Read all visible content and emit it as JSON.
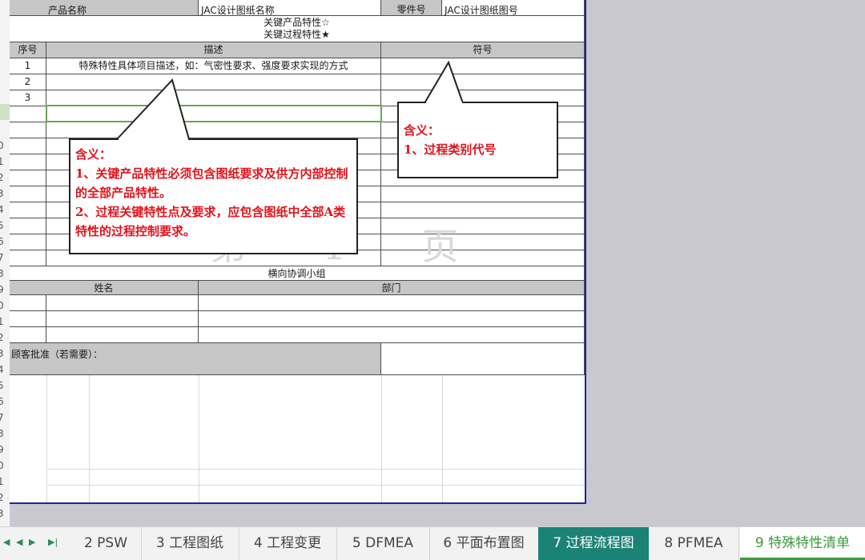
{
  "row_headers": [
    "",
    "",
    "",
    "",
    "",
    "",
    "",
    "",
    "0",
    "1",
    "2",
    "3",
    "4",
    "5",
    "6",
    "7",
    "8",
    "9",
    "0",
    "1",
    "2",
    "3",
    "4",
    "5",
    "6",
    "7",
    "8",
    "9",
    "0",
    "1",
    "2",
    "3"
  ],
  "header": {
    "product_name_label": "产品名称",
    "product_name_value": "JAC设计图纸名称",
    "part_no_label": "零件号",
    "part_no_value": "JAC设计图纸图号",
    "key_product_char": "关键产品特性☆",
    "key_process_char": "关键过程特性★"
  },
  "table": {
    "col_seq": "序号",
    "col_desc": "描述",
    "col_symbol": "符号",
    "rows": [
      {
        "seq": "1",
        "desc": "特殊特性具体项目描述，如：气密性要求、强度要求实现的方式"
      },
      {
        "seq": "2",
        "desc": ""
      },
      {
        "seq": "3",
        "desc": ""
      }
    ]
  },
  "team": {
    "title": "横向协调小组",
    "col_name": "姓名",
    "col_dept": "部门"
  },
  "approval_label": "顾客批准（若需要）：",
  "watermark": "第 1 页",
  "callout_left": {
    "line1": "含义：",
    "line2": "1、关键产品特性必须包含图纸要求及供方内部控制的全部产品特性。",
    "line3": "2、过程关键特性点及要求，应包含图纸中全部A类特性的过程控制要求。"
  },
  "callout_right": {
    "line1": "含义：",
    "line2": "1、过程类别代号"
  },
  "tabs": [
    "2 PSW",
    "3 工程图纸",
    "4 工程变更",
    "5 DFMEA",
    "6 平面布置图",
    "7 过程流程图",
    "8 PFMEA",
    "9 特殊特性清单"
  ],
  "colors": {
    "teal_tab": "#1b8276",
    "active_green": "#3d9a3d",
    "callout_red": "#e2131b",
    "sheet_border": "#1a23a8"
  }
}
